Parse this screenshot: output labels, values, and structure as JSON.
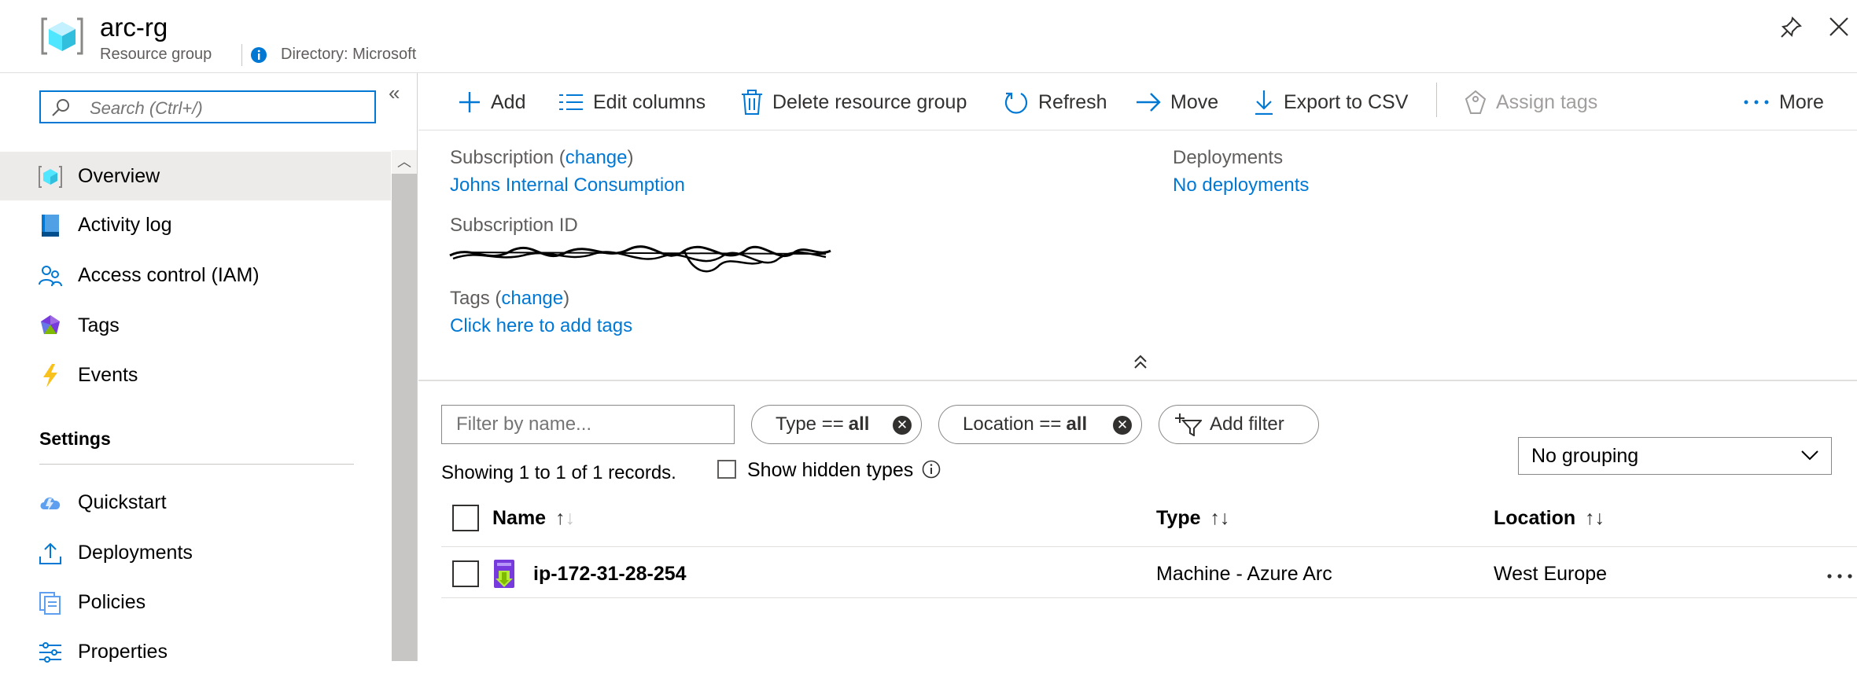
{
  "header": {
    "title": "arc-rg",
    "subtitle": "Resource group",
    "directory": "Directory: Microsoft"
  },
  "sidebar": {
    "search_placeholder": "Search (Ctrl+/)",
    "items": [
      {
        "label": "Overview",
        "icon": "resource-group-icon"
      },
      {
        "label": "Activity log",
        "icon": "activity-log-icon"
      },
      {
        "label": "Access control (IAM)",
        "icon": "people-icon"
      },
      {
        "label": "Tags",
        "icon": "tag-icon"
      },
      {
        "label": "Events",
        "icon": "lightning-icon"
      }
    ],
    "settings_heading": "Settings",
    "settings_items": [
      {
        "label": "Quickstart",
        "icon": "cloud-icon"
      },
      {
        "label": "Deployments",
        "icon": "upload-icon"
      },
      {
        "label": "Policies",
        "icon": "policy-icon"
      },
      {
        "label": "Properties",
        "icon": "sliders-icon"
      }
    ]
  },
  "toolbar": {
    "add": "Add",
    "edit_columns": "Edit columns",
    "delete": "Delete resource group",
    "refresh": "Refresh",
    "move": "Move",
    "export": "Export to CSV",
    "assign_tags": "Assign tags",
    "more": "More"
  },
  "essentials": {
    "subscription_label": "Subscription",
    "change": "change",
    "subscription_value": "Johns Internal Consumption",
    "subscription_id_label": "Subscription ID",
    "tags_label": "Tags",
    "tags_value": "Click here to add tags",
    "deployments_label": "Deployments",
    "deployments_value": "No deployments"
  },
  "filters": {
    "name_placeholder": "Filter by name...",
    "type_pill": {
      "key": "Type ==",
      "value": "all"
    },
    "location_pill": {
      "key": "Location ==",
      "value": "all"
    },
    "add_filter": "Add filter",
    "showing": "Showing 1 to 1 of 1 records.",
    "show_hidden": "Show hidden types",
    "grouping": "No grouping"
  },
  "grid": {
    "columns": [
      "Name",
      "Type",
      "Location"
    ],
    "rows": [
      {
        "name": "ip-172-31-28-254",
        "type": "Machine - Azure Arc",
        "location": "West Europe"
      }
    ]
  }
}
